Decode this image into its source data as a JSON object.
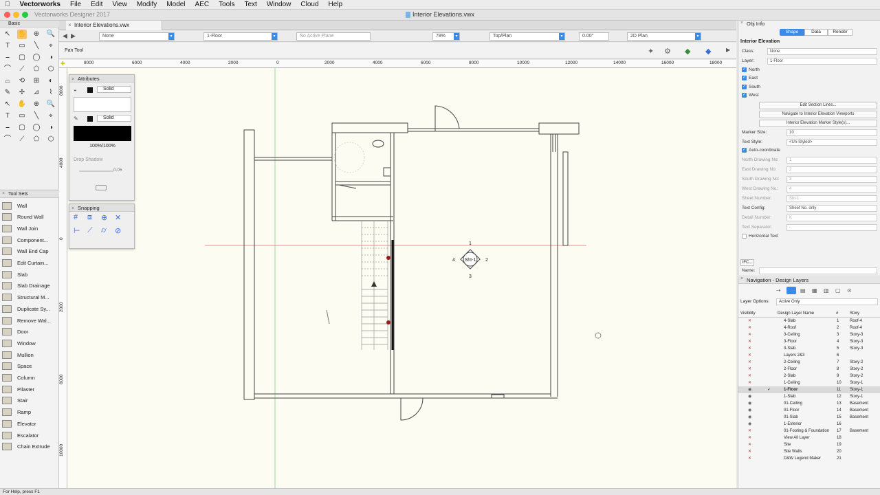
{
  "menubar": {
    "apple_icon": "apple-icon",
    "app_name": "Vectorworks",
    "items": [
      "File",
      "Edit",
      "View",
      "Modify",
      "Model",
      "AEC",
      "Tools",
      "Text",
      "Window",
      "Cloud",
      "Help"
    ]
  },
  "window": {
    "app_title": "Vectorworks Designer 2017",
    "doc_title": "Interior Elevations.vwx",
    "tab_label": "Interior Elevations.vwx"
  },
  "left_palette": {
    "title": "Basic"
  },
  "view_bar": {
    "class_select": "None",
    "layer_select": "1-Floor",
    "plane_select": "No Active Plane",
    "zoom": "78%",
    "view_select": "Top/Plan",
    "rotation": "0.00°",
    "render_select": "2D Plan"
  },
  "mode_bar": {
    "tool_name": "Pan Tool"
  },
  "ruler_top": [
    "8000",
    "6000",
    "4000",
    "2000",
    "0",
    "2000",
    "4000",
    "6000",
    "8000",
    "10000",
    "12000",
    "14000",
    "16000",
    "18000"
  ],
  "ruler_left": [
    "8000",
    "4000",
    "0",
    "2000",
    "6000",
    "10000"
  ],
  "attributes": {
    "title": "Attributes",
    "fill_style": "Solid",
    "pen_style": "Solid",
    "opacity": "100%/100%",
    "drop_shadow": "Drop Shadow",
    "shadow_value": "0.05"
  },
  "snapping": {
    "title": "Snapping"
  },
  "tool_sets": {
    "title": "Tool Sets",
    "items": [
      "Wall",
      "Round Wall",
      "Wall Join",
      "Component...",
      "Wall End Cap",
      "Edit Curtain...",
      "Slab",
      "Slab Drainage",
      "Structural M...",
      "Duplicate Sy...",
      "Remove Wal...",
      "Door",
      "Window",
      "Mullion",
      "Space",
      "Column",
      "Pilaster",
      "Stair",
      "Ramp",
      "Elevator",
      "Escalator",
      "Chain Extrude"
    ]
  },
  "marker": {
    "label": "Sht-1",
    "n": "1",
    "e": "2",
    "s": "3",
    "w": "4"
  },
  "obj_info": {
    "title": "Obj Info",
    "tabs": [
      "Shape",
      "Data",
      "Render"
    ],
    "object_type": "Interior Elevation",
    "class_label": "Class:",
    "class_value": "None",
    "layer_label": "Layer:",
    "layer_value": "1-Floor",
    "directions": [
      "North",
      "East",
      "South",
      "West"
    ],
    "buttons": [
      "Edit Section Lines...",
      "Navigate to Interior Elevation Viewports",
      "Interior Elevation Marker Style(s)..."
    ],
    "marker_size_label": "Marker Size:",
    "marker_size": "10",
    "text_style_label": "Text Style:",
    "text_style": "<Un-Styled>",
    "auto_coordinate": "Auto-coordinate",
    "north_label": "North Drawing No:",
    "north_value": "1",
    "east_label": "East Drawing No:",
    "east_value": "2",
    "south_label": "South Drawing No:",
    "south_value": "3",
    "west_label": "West Drawing No:",
    "west_value": "4",
    "sheet_label": "Sheet Number:",
    "sheet_value": "Sht-1",
    "text_config_label": "Text Config:",
    "text_config": "Sheet No. only",
    "detail_label": "Detail Number:",
    "detail_value": "K",
    "sep_label": "Text Separator:",
    "sep_value": "-",
    "horizontal_text": "Horizontal Text",
    "ifc": "IFC...",
    "name_label": "Name:"
  },
  "navigation": {
    "title": "Navigation - Design Layers",
    "layer_options_label": "Layer Options:",
    "layer_options": "Active Only",
    "columns": [
      "Visibility",
      "Design Layer Name",
      "#",
      "Story"
    ],
    "layers": [
      {
        "vis": "x",
        "name": "4-Slab",
        "num": "1",
        "story": "Roof-4"
      },
      {
        "vis": "x",
        "name": "4-Roof",
        "num": "2",
        "story": "Roof-4"
      },
      {
        "vis": "x",
        "name": "3-Ceiling",
        "num": "3",
        "story": "Story-3"
      },
      {
        "vis": "x",
        "name": "3-Floor",
        "num": "4",
        "story": "Story-3"
      },
      {
        "vis": "x",
        "name": "3-Slab",
        "num": "5",
        "story": "Story-3"
      },
      {
        "vis": "x",
        "name": "Layers 2&3",
        "num": "6",
        "story": ""
      },
      {
        "vis": "x",
        "name": "2-Ceiling",
        "num": "7",
        "story": "Story-2"
      },
      {
        "vis": "x",
        "name": "2-Floor",
        "num": "8",
        "story": "Story-2"
      },
      {
        "vis": "x",
        "name": "2-Slab",
        "num": "9",
        "story": "Story-2"
      },
      {
        "vis": "x",
        "name": "1-Ceiling",
        "num": "10",
        "story": "Story-1"
      },
      {
        "vis": "eye",
        "name": "1-Floor",
        "num": "11",
        "story": "Story-1",
        "active": true
      },
      {
        "vis": "eye",
        "name": "1-Slab",
        "num": "12",
        "story": "Story-1"
      },
      {
        "vis": "eye",
        "name": "01-Ceiling",
        "num": "13",
        "story": "Basement"
      },
      {
        "vis": "eye",
        "name": "01-Floor",
        "num": "14",
        "story": "Basement"
      },
      {
        "vis": "eye",
        "name": "01-Slab",
        "num": "15",
        "story": "Basement"
      },
      {
        "vis": "eye",
        "name": "1-Exterior",
        "num": "16",
        "story": ""
      },
      {
        "vis": "x",
        "name": "01-Footing & Foundation",
        "num": "17",
        "story": "Basement"
      },
      {
        "vis": "x",
        "name": "View All Layer",
        "num": "18",
        "story": ""
      },
      {
        "vis": "x",
        "name": "Site",
        "num": "19",
        "story": ""
      },
      {
        "vis": "x",
        "name": "Site Walls",
        "num": "20",
        "story": ""
      },
      {
        "vis": "x",
        "name": "D&W Legend Maker",
        "num": "21",
        "story": ""
      }
    ]
  },
  "status": {
    "text": "For Help, press F1"
  }
}
